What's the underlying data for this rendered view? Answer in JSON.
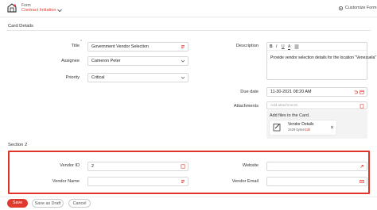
{
  "header": {
    "form_label": "Form",
    "form_name": "Contract Initiation",
    "customize_label": "Customize Form"
  },
  "card_details": {
    "section_title": "Card Details",
    "title": {
      "label": "Title",
      "value": "Government Vendor Selection"
    },
    "assignee": {
      "label": "Assignee",
      "value": "Cameron Peter"
    },
    "priority": {
      "label": "Priority",
      "value": "Critical"
    },
    "description": {
      "label": "Description",
      "toolbar": [
        "B",
        "I",
        "U",
        "A",
        "list"
      ],
      "text": "Provide vendor selection details for the location \"Venezuela\""
    },
    "due_date": {
      "label": "Due date",
      "value": "11-30-2021 08:20 AM"
    },
    "attachments": {
      "label": "Attachments",
      "placeholder": "Add attachments",
      "drop_text": "Add files to the Card.",
      "file": {
        "name": "Vendor Details",
        "size": "3429 bytes",
        "action": "Edit"
      }
    }
  },
  "section2": {
    "title": "Section 2",
    "vendor_id": {
      "label": "Vendor ID",
      "value": "2"
    },
    "vendor_name": {
      "label": "Vendor Name",
      "value": ""
    },
    "website": {
      "label": "Website",
      "value": ""
    },
    "vendor_email": {
      "label": "Vendor Email",
      "value": ""
    }
  },
  "footer": {
    "save": "Save",
    "save_draft": "Save as Draft",
    "cancel": "Cancel"
  },
  "colors": {
    "accent": "#e03a2e",
    "highlight_border": "#e0342a",
    "header_bg": "#ffffff",
    "panel_bg": "#ffffff"
  }
}
